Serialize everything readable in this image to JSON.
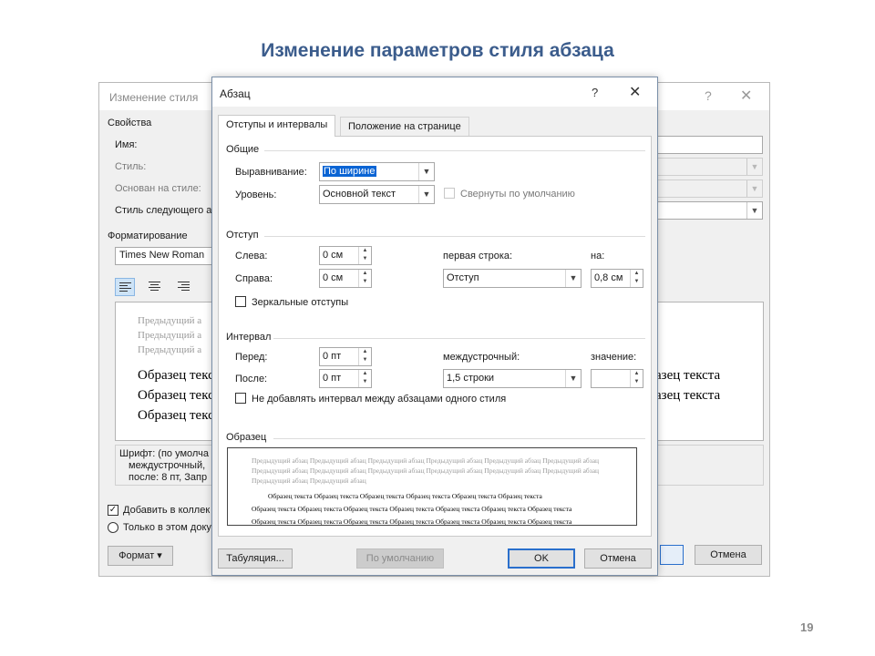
{
  "slide": {
    "title": "Изменение параметров стиля абзаца",
    "page_number": "19"
  },
  "bg_dialog": {
    "title": "Изменение стиля",
    "help_glyph": "?",
    "close_glyph": "✕",
    "properties_header": "Свойства",
    "name_label": "Имя:",
    "style_label": "Стиль:",
    "based_on_label": "Основан на стиле:",
    "next_style_label": "Стиль следующего а",
    "formatting_header": "Форматирование",
    "font_value": "Times New Roman",
    "preview_prev": [
      "Предыдущий а",
      "Предыдущий а",
      "Предыдущий а"
    ],
    "preview_sample_left": [
      "Образец текс",
      "Образец текс",
      "Образец текс"
    ],
    "preview_sample_right": [
      "азец текста",
      "азец текста"
    ],
    "desc": [
      "Шрифт: (по умолча",
      "междустрочный,",
      "после: 8 пт, Запр"
    ],
    "add_to_gallery_label": "Добавить в коллек",
    "only_this_doc_label": "Только в этом доку",
    "format_button": "Формат ▾",
    "cancel_button": "Отмена"
  },
  "dialog": {
    "title": "Абзац",
    "help_glyph": "?",
    "close_glyph": "✕",
    "tabs": {
      "indents": "Отступы и интервалы",
      "position": "Положение на странице"
    },
    "general": {
      "header": "Общие",
      "alignment_label": "Выравнивание:",
      "alignment_value": "По ширине",
      "level_label": "Уровень:",
      "level_value": "Основной текст",
      "collapsed_label": "Свернуты по умолчанию"
    },
    "indent": {
      "header": "Отступ",
      "left_label": "Слева:",
      "left_value": "0 см",
      "right_label": "Справа:",
      "right_value": "0 см",
      "first_line_label": "первая строка:",
      "first_line_value": "Отступ",
      "by_label": "на:",
      "by_value": "0,8 см",
      "mirror_label": "Зеркальные отступы"
    },
    "spacing": {
      "header": "Интервал",
      "before_label": "Перед:",
      "before_value": "0 пт",
      "after_label": "После:",
      "after_value": "0 пт",
      "line_label": "междустрочный:",
      "line_value": "1,5 строки",
      "at_label": "значение:",
      "at_value": "",
      "no_space_label": "Не добавлять интервал между абзацами одного стиля"
    },
    "sample": {
      "header": "Образец",
      "prev_lines": [
        "Предыдущий абзац Предыдущий абзац Предыдущий абзац Предыдущий абзац Предыдущий абзац Предыдущий абзац",
        "Предыдущий абзац Предыдущий абзац Предыдущий абзац Предыдущий абзац Предыдущий абзац Предыдущий абзац",
        "Предыдущий абзац Предыдущий абзац"
      ],
      "sample_lines": [
        "Образец текста Образец текста Образец текста Образец текста Образец текста Образец текста",
        "Образец текста Образец текста Образец текста Образец текста Образец текста Образец текста Образец текста",
        "Образец текста Образец текста Образец текста Образец текста Образец текста Образец текста Образец текста",
        "текста Образец текста Образец текста Образец текста Образец текста"
      ]
    },
    "buttons": {
      "tabs": "Табуляция...",
      "default": "По умолчанию",
      "ok": "OK",
      "cancel": "Отмена"
    }
  }
}
